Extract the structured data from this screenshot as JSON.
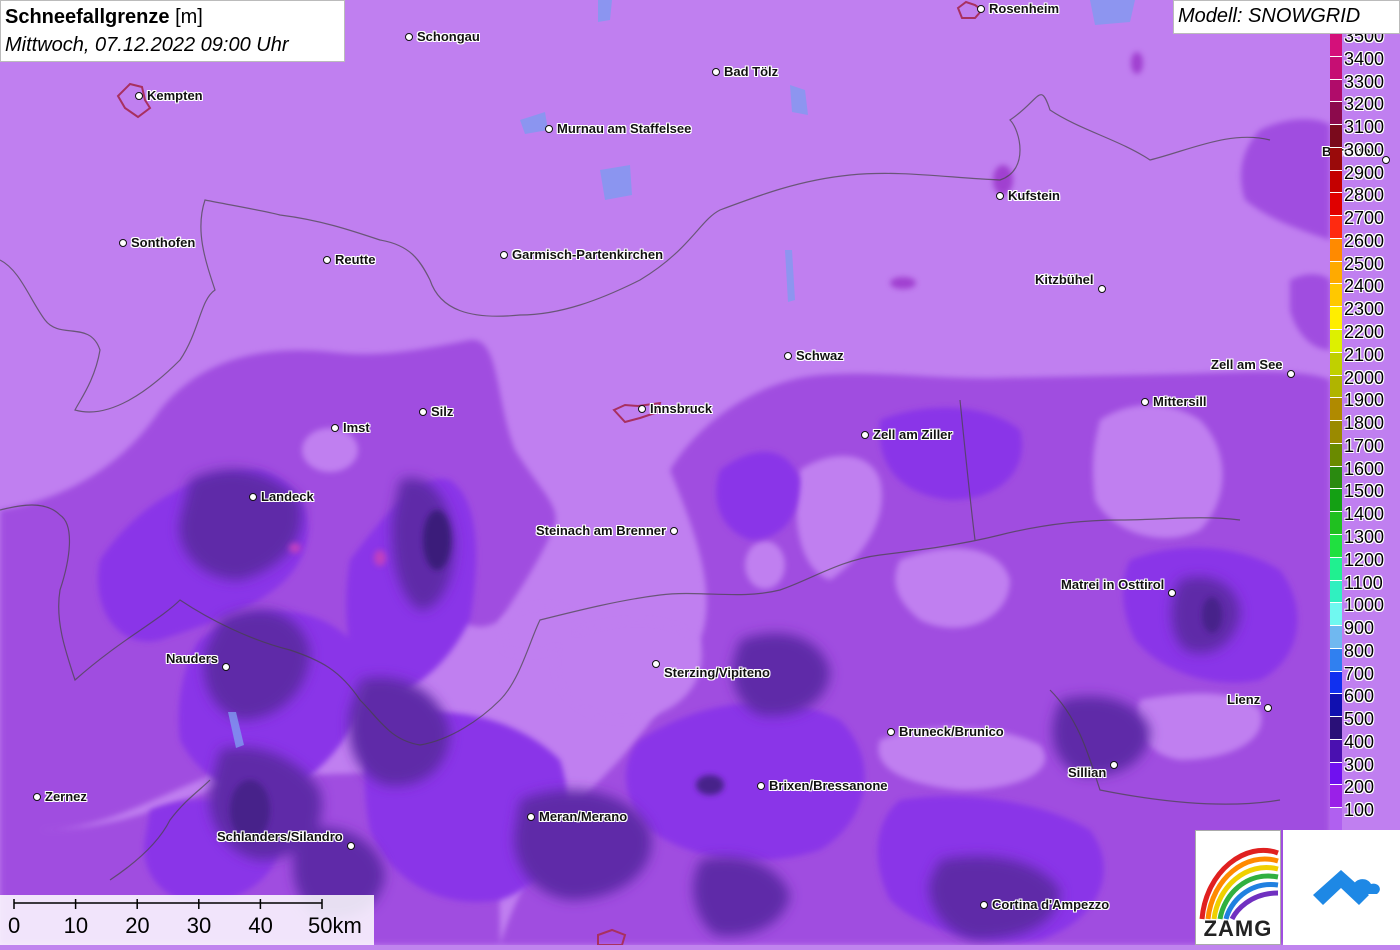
{
  "title": {
    "main": "Schneefallgrenze",
    "unit": " [m]",
    "date": "Mittwoch, 07.12.2022 09:00 Uhr"
  },
  "model": "Modell: SNOWGRID",
  "cities": [
    {
      "name": "Rosenheim",
      "label_side": "right"
    },
    {
      "name": "Schongau",
      "label_side": "right"
    },
    {
      "name": "Bad Tölz",
      "label_side": "right"
    },
    {
      "name": "Kempten",
      "label_side": "right"
    },
    {
      "name": "Murnau am Staffelsee",
      "label_side": "right"
    },
    {
      "name": "Berchtes",
      "label_side": "left"
    },
    {
      "name": "Kufstein",
      "label_side": "right"
    },
    {
      "name": "Sonthofen",
      "label_side": "right"
    },
    {
      "name": "Reutte",
      "label_side": "right"
    },
    {
      "name": "Garmisch-Partenkirchen",
      "label_side": "right"
    },
    {
      "name": "Kitzbühel",
      "label_side": "left"
    },
    {
      "name": "Schwaz",
      "label_side": "right"
    },
    {
      "name": "Zell am See",
      "label_side": "left"
    },
    {
      "name": "Mittersill",
      "label_side": "right"
    },
    {
      "name": "Innsbruck",
      "label_side": "right"
    },
    {
      "name": "Silz",
      "label_side": "right"
    },
    {
      "name": "Imst",
      "label_side": "right"
    },
    {
      "name": "Zell am Ziller",
      "label_side": "right"
    },
    {
      "name": "Landeck",
      "label_side": "right"
    },
    {
      "name": "Steinach am Brenner",
      "label_side": "left"
    },
    {
      "name": "Matrei in Osttirol",
      "label_side": "left"
    },
    {
      "name": "Nauders",
      "label_side": "left"
    },
    {
      "name": "Sterzing/Vipiteno",
      "label_side": "right"
    },
    {
      "name": "Lienz",
      "label_side": "left"
    },
    {
      "name": "Bruneck/Brunico",
      "label_side": "right"
    },
    {
      "name": "Sillian",
      "label_side": "left"
    },
    {
      "name": "Brixen/Bressanone",
      "label_side": "right"
    },
    {
      "name": "Zernez",
      "label_side": "right"
    },
    {
      "name": "Meran/Merano",
      "label_side": "right"
    },
    {
      "name": "Schlanders/Silandro",
      "label_side": "left"
    },
    {
      "name": "Cortina d'Ampezzo",
      "label_side": "right"
    }
  ],
  "legend": [
    {
      "value": "3500",
      "color": "#d4107a"
    },
    {
      "value": "3400",
      "color": "#c60e73"
    },
    {
      "value": "3300",
      "color": "#b00c6a"
    },
    {
      "value": "3200",
      "color": "#8c0a4c"
    },
    {
      "value": "3100",
      "color": "#7a0a1c"
    },
    {
      "value": "3000",
      "color": "#9a0a0a"
    },
    {
      "value": "2900",
      "color": "#c40000"
    },
    {
      "value": "2800",
      "color": "#e00000"
    },
    {
      "value": "2700",
      "color": "#ff2a10"
    },
    {
      "value": "2600",
      "color": "#ff8a00"
    },
    {
      "value": "2500",
      "color": "#ffaa00"
    },
    {
      "value": "2400",
      "color": "#ffc800"
    },
    {
      "value": "2300",
      "color": "#ffee00"
    },
    {
      "value": "2200",
      "color": "#ddf000"
    },
    {
      "value": "2100",
      "color": "#c0d000"
    },
    {
      "value": "2000",
      "color": "#b0b400"
    },
    {
      "value": "1900",
      "color": "#b08a00"
    },
    {
      "value": "1800",
      "color": "#9a8a00"
    },
    {
      "value": "1700",
      "color": "#6a8a00"
    },
    {
      "value": "1600",
      "color": "#2a8a10"
    },
    {
      "value": "1500",
      "color": "#14a014"
    },
    {
      "value": "1400",
      "color": "#20c020"
    },
    {
      "value": "1300",
      "color": "#20e040"
    },
    {
      "value": "1200",
      "color": "#20f090"
    },
    {
      "value": "1100",
      "color": "#30f0c0"
    },
    {
      "value": "1000",
      "color": "#70f8f0"
    },
    {
      "value": "900",
      "color": "#70b8f0"
    },
    {
      "value": "800",
      "color": "#3080f0"
    },
    {
      "value": "700",
      "color": "#1030f0"
    },
    {
      "value": "600",
      "color": "#1010b0"
    },
    {
      "value": "500",
      "color": "#2a1078"
    },
    {
      "value": "400",
      "color": "#4a10b0"
    },
    {
      "value": "300",
      "color": "#7010f0"
    },
    {
      "value": "200",
      "color": "#9a20e8"
    },
    {
      "value": "100",
      "color": "#b060f0"
    }
  ],
  "scale": {
    "ticks": [
      "0",
      "10",
      "20",
      "30",
      "40",
      "50km"
    ]
  },
  "logos": {
    "zamg": "ZAMG"
  },
  "icons": {
    "zamg_logo": "rainbow-arc-icon",
    "cloud_logo": "cloud-arrow-icon"
  }
}
